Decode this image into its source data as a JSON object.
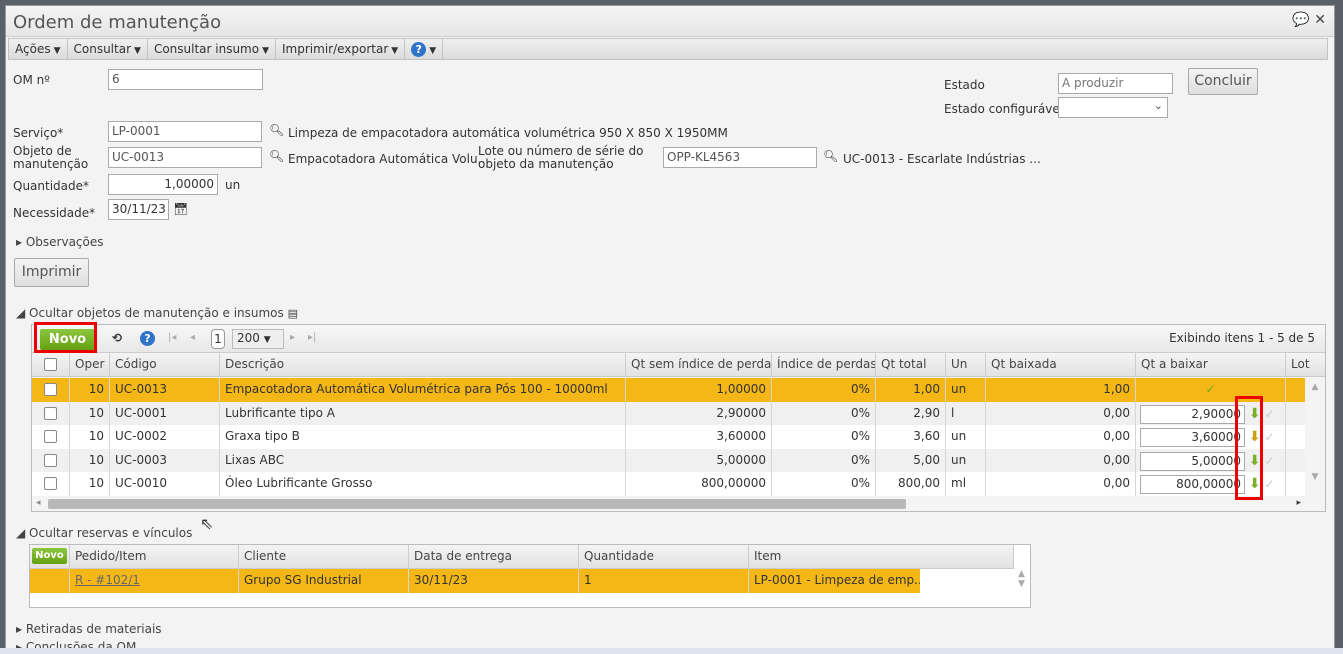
{
  "window": {
    "title": "Ordem de manutenção"
  },
  "menu": [
    "Ações",
    "Consultar",
    "Consultar insumo",
    "Imprimir/exportar"
  ],
  "form": {
    "om_label": "OM nº",
    "om_value": "6",
    "estado_label": "Estado",
    "estado_value": "A produzir",
    "estado_conf_label": "Estado configurável",
    "estado_conf_value": "",
    "concluir": "Concluir",
    "servico_label": "Serviço*",
    "servico_value": "LP-0001",
    "servico_desc": "Limpeza de empacotadora automática volumétrica 950 X 850 X 1950MM",
    "objeto_label": "Objeto de manutenção",
    "objeto_value": "UC-0013",
    "objeto_desc": "Empacotadora Automática Volu...",
    "lote_label": "Lote ou número de série do objeto da manutenção",
    "lote_value": "OPP-KL4563",
    "lote_desc": "UC-0013 - Escarlate Indústrias ...",
    "quantidade_label": "Quantidade*",
    "quantidade_value": "1,00000",
    "quantidade_unit": "un",
    "necessidade_label": "Necessidade*",
    "necessidade_value": "30/11/23",
    "observacoes": "Observações",
    "imprimir": "Imprimir"
  },
  "insumos": {
    "section": "Ocultar objetos de manutenção e insumos",
    "novo": "Novo",
    "page": "1",
    "page_size": "200",
    "info": "Exibindo itens 1 - 5 de 5",
    "columns": [
      "Oper",
      "Código",
      "Descrição",
      "Qt sem índice de perdas",
      "Índice de perdas",
      "Qt total",
      "Un",
      "Qt baixada",
      "Qt a baixar",
      "Lot"
    ],
    "rows": [
      {
        "oper": "10",
        "codigo": "UC-0013",
        "descricao": "Empacotadora Automática Volumétrica para Pós 100 - 10000ml",
        "qt_sem": "1,00000",
        "indice": "0%",
        "qt_total": "1,00",
        "un": "un",
        "qt_baixada": "1,00",
        "qt_a_baixar": ""
      },
      {
        "oper": "10",
        "codigo": "UC-0001",
        "descricao": "Lubrificante tipo A",
        "qt_sem": "2,90000",
        "indice": "0%",
        "qt_total": "2,90",
        "un": "l",
        "qt_baixada": "0,00",
        "qt_a_baixar": "2,90000"
      },
      {
        "oper": "10",
        "codigo": "UC-0002",
        "descricao": "Graxa tipo B",
        "qt_sem": "3,60000",
        "indice": "0%",
        "qt_total": "3,60",
        "un": "un",
        "qt_baixada": "0,00",
        "qt_a_baixar": "3,60000"
      },
      {
        "oper": "10",
        "codigo": "UC-0003",
        "descricao": "Lixas ABC",
        "qt_sem": "5,00000",
        "indice": "0%",
        "qt_total": "5,00",
        "un": "un",
        "qt_baixada": "0,00",
        "qt_a_baixar": "5,00000"
      },
      {
        "oper": "10",
        "codigo": "UC-0010",
        "descricao": "Óleo Lubrificante Grosso",
        "qt_sem": "800,00000",
        "indice": "0%",
        "qt_total": "800,00",
        "un": "ml",
        "qt_baixada": "0,00",
        "qt_a_baixar": "800,00000"
      }
    ]
  },
  "reservas": {
    "section": "Ocultar reservas e vínculos",
    "novo": "Novo",
    "columns": [
      "Pedido/Item",
      "Cliente",
      "Data de entrega",
      "Quantidade",
      "Item"
    ],
    "rows": [
      {
        "pedido": "R - #102/1",
        "cliente": "Grupo SG Industrial",
        "data": "30/11/23",
        "quantidade": "1",
        "item": "LP-0001 - Limpeza de emp..."
      }
    ]
  },
  "sections": [
    "Retiradas de materiais",
    "Conclusões da OM"
  ]
}
